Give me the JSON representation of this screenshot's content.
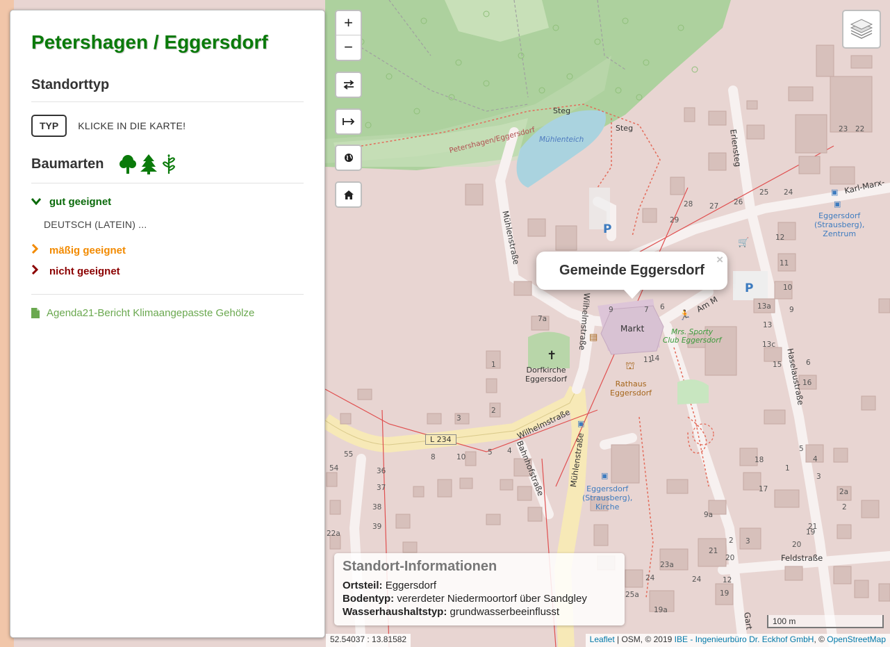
{
  "sidebar": {
    "title": "Petershagen / Eggersdorf",
    "location_type": {
      "heading": "Standorttyp",
      "button_label": "TYP",
      "hint": "KLICKE IN DIE KARTE!"
    },
    "tree_species": {
      "heading": "Baumarten",
      "icons": [
        "deciduous-tree-icon",
        "conifer-tree-icon",
        "sapling-icon"
      ],
      "categories": [
        {
          "label": "gut geeignet",
          "state": "expanded",
          "color": "#0a6a0a"
        },
        {
          "label": "mäßig geeignet",
          "state": "collapsed",
          "color": "#f28a00"
        },
        {
          "label": "nicht geeignet",
          "state": "collapsed",
          "color": "#8b0000"
        }
      ],
      "species_placeholder": "DEUTSCH (LATEIN) ..."
    },
    "report_link": "Agenda21-Bericht Klimaangepasste Gehölze"
  },
  "controls": {
    "zoom_in": "+",
    "zoom_out": "−",
    "buttons": [
      "swap-icon",
      "measure-icon",
      "globe-icon",
      "home-icon"
    ],
    "layers": "layers-icon"
  },
  "popup": {
    "title": "Gemeinde Eggersdorf",
    "close": "×"
  },
  "info_box": {
    "title": "Standort-Informationen",
    "rows": [
      {
        "key": "Ortsteil:",
        "value": "Eggersdorf"
      },
      {
        "key": "Bodentyp:",
        "value": "vererdeter Niedermoortorf über Sandgley"
      },
      {
        "key": "Wasserhaushaltstyp:",
        "value": "grundwasserbeeinflusst"
      }
    ]
  },
  "map": {
    "coordinates": "52.54037 : 13.81582",
    "scale": "100 m",
    "attribution": {
      "leaflet": "Leaflet",
      "osm": " | OSM, © 2019 ",
      "ibe": "IBE - Ingenieurbüro Dr. Eckhof GmbH",
      "sep": ", © ",
      "osm_link": "OpenStreetMap"
    },
    "labels": {
      "steg1": "Steg",
      "steg2": "Steg",
      "muehlenteich": "Mühlenteich",
      "border": "Petershagen/Eggersdorf",
      "erlensteg": "Erlensteg",
      "karl_marx": "Karl-Marx-",
      "muehlenstrasse_n": "Mühlenstraße",
      "wilhelmstrasse_v": "Wilhelmstraße",
      "wilhelmstrasse_h": "Wilhelmstraße",
      "bahnhofstrasse": "Bahnhofstraße",
      "muehlenstrasse_s": "Mühlenstraße",
      "haselaustrasse": "Haselaustraße",
      "feldstrasse": "Feldstraße",
      "am_markt": "Am M",
      "l234": "L 234",
      "markt": "Markt",
      "dorfkirche": "Dorfkirche\nEggersdorf",
      "rathaus": "Rathaus\nEggersdorf",
      "sporty": "Mrs. Sporty\nClub Eggersdorf",
      "stop_zentrum": "Eggersdorf\n(Strausberg),\nZentrum",
      "stop_kirche": "Eggersdorf\n(Strausberg),\nKirche",
      "garten": "Gart",
      "p1": "P",
      "p2": "P"
    },
    "house_numbers": [
      "23",
      "22",
      "25",
      "24",
      "28",
      "27",
      "26",
      "29",
      "12",
      "11",
      "10",
      "9",
      "13a",
      "13",
      "13c",
      "15",
      "16",
      "6",
      "5",
      "4",
      "3",
      "2a",
      "2",
      "1",
      "18",
      "17",
      "19",
      "20",
      "21",
      "9a",
      "7a",
      "7",
      "6",
      "8",
      "10",
      "9",
      "5",
      "4",
      "3",
      "1",
      "2",
      "14",
      "11",
      "55",
      "54",
      "36",
      "37",
      "38",
      "39",
      "22a",
      "24",
      "23a",
      "25a",
      "19a",
      "19",
      "12",
      "24",
      "21",
      "20",
      "2",
      "3"
    ]
  }
}
